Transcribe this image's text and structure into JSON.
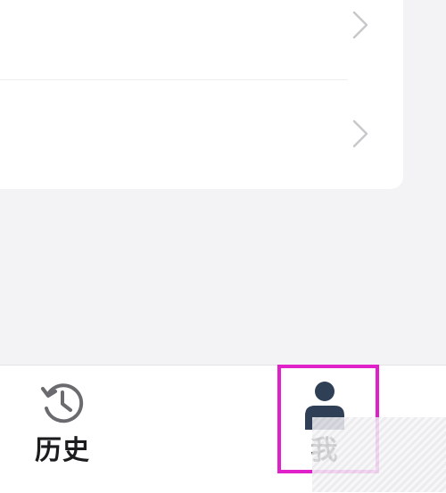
{
  "settings": {
    "rows": [
      {
        "name": "row-1"
      },
      {
        "name": "row-2"
      }
    ],
    "chevron_icon": "chevron-right-icon"
  },
  "tabbar": {
    "tabs": [
      {
        "label": "历史",
        "icon": "history-icon",
        "selected": false
      },
      {
        "label": "我",
        "icon": "person-icon",
        "selected": true
      }
    ]
  },
  "colors": {
    "background": "#f3f2f4",
    "card": "#ffffff",
    "highlight": "#e020c8",
    "active_icon": "#2f3f56",
    "inactive_icon": "#6b6b6f"
  }
}
